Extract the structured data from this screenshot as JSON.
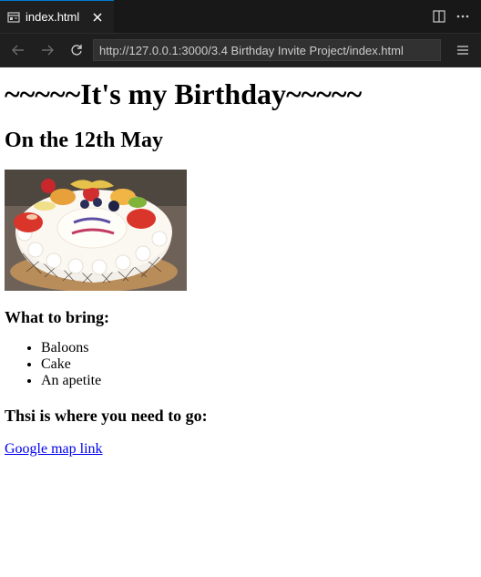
{
  "tab": {
    "title": "index.html"
  },
  "toolbar": {
    "url": "http://127.0.0.1:3000/3.4 Birthday Invite Project/index.html"
  },
  "page": {
    "heading": "~~~~~It's my Birthday~~~~~",
    "subheading": "On the 12th May",
    "bring_heading": "What to bring:",
    "bring_items": [
      "Baloons",
      "Cake",
      "An apetite"
    ],
    "location_heading": "Thsi is where you need to go:",
    "map_link": "Google map link"
  }
}
